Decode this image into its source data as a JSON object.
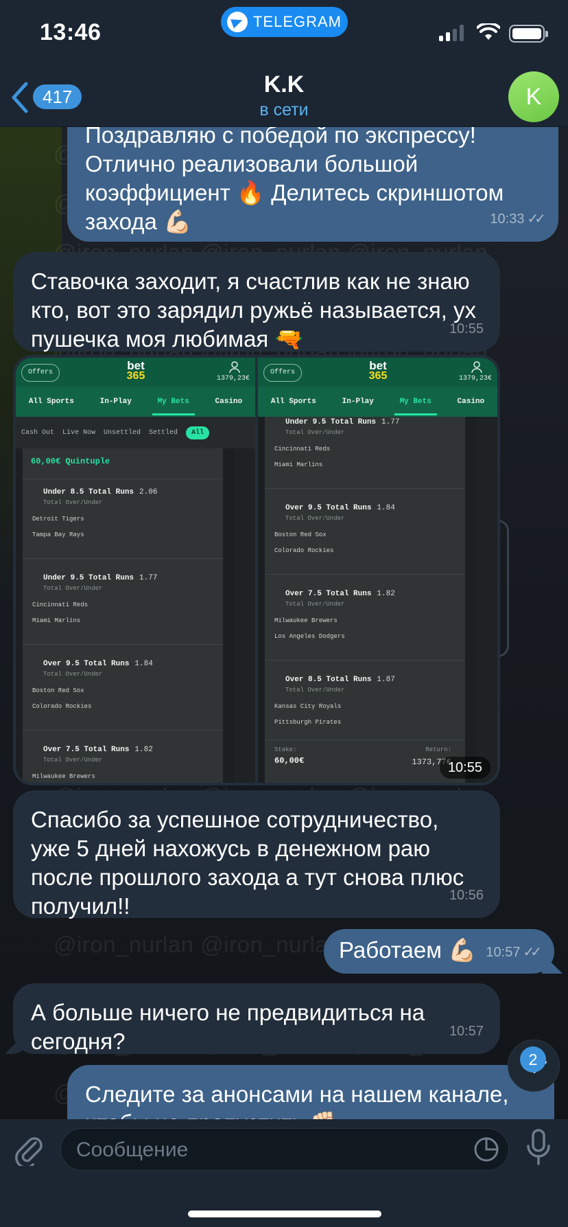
{
  "status_bar": {
    "time": "13:46",
    "pill": "TELEGRAM"
  },
  "header": {
    "back_count": "417",
    "title": "K.K",
    "status": "в сети",
    "avatar_letter": "K"
  },
  "watermark": "@iron_nurlan  @iron_nurlan  @iron_nurlan",
  "messages": [
    {
      "id": "m1",
      "dir": "out",
      "text": "Поздравляю с победой по экспрессу! Отлично реализовали большой коэффициент 🔥 Делитесь скриншотом захода 💪🏻",
      "time": "10:33"
    },
    {
      "id": "m2",
      "dir": "in",
      "text": "Ставочка заходит, я счастлив как не знаю кто, вот это зарядил ружьё называется, ух пушечка моя любимая 🔫",
      "time": "10:55"
    },
    {
      "id": "m3",
      "dir": "in",
      "type": "media",
      "time": "10:55"
    },
    {
      "id": "m4",
      "dir": "in",
      "text": "Спасибо за успешное сотрудничество, уже 5 дней нахожусь в денежном раю после прошлого захода а тут снова плюс получил!!",
      "time": "10:56"
    },
    {
      "id": "m5",
      "dir": "out",
      "text": "Работаем 💪🏻",
      "time": "10:57"
    },
    {
      "id": "m6",
      "dir": "in",
      "text": "А больше ничего не предвидиться на сегодня?",
      "time": "10:57"
    },
    {
      "id": "m7",
      "dir": "out",
      "text": "Следите за анонсами на нашем канале, чтобы не пропустить ✊🏻",
      "time": ""
    }
  ],
  "bet_app": {
    "offers": "Offers",
    "logo_top": "bet",
    "logo_bottom": "365",
    "balance": "1379,23€",
    "nav": [
      "All Sports",
      "In-Play",
      "My Bets",
      "Casino"
    ],
    "filters": [
      "Cash Out",
      "Live Now",
      "Unsettled",
      "Settled",
      "All"
    ],
    "bet_title": "60,00€ Quintuple",
    "selections": [
      {
        "name": "Under 8.5 Total Runs",
        "odds": "2.06",
        "market": "Total Over/Under",
        "team1": "Detroit Tigers",
        "team2": "Tampa Bay Rays"
      },
      {
        "name": "Under 9.5 Total Runs",
        "odds": "1.77",
        "market": "Total Over/Under",
        "team1": "Cincinnati Reds",
        "team2": "Miami Marlins"
      },
      {
        "name": "Over 9.5 Total Runs",
        "odds": "1.84",
        "market": "Total Over/Under",
        "team1": "Boston Red Sox",
        "team2": "Colorado Rockies"
      },
      {
        "name": "Over 7.5 Total Runs",
        "odds": "1.82",
        "market": "Total Over/Under",
        "team1": "Milwaukee Brewers",
        "team2": "Los Angeles Dodgers"
      },
      {
        "name": "Over 8.5 Total Runs",
        "odds": "1.87",
        "market": "Total Over/Under",
        "team1": "Kansas City Royals",
        "team2": "Pittsburgh Pirates"
      }
    ],
    "stake_label": "Stake:",
    "stake_value": "60,00€",
    "return_label": "Return:",
    "return_value": "1373,77€"
  },
  "fab": {
    "badge": "2"
  },
  "input": {
    "placeholder": "Сообщение"
  },
  "colors": {
    "bubble_in": "#232e3c",
    "bubble_out": "#3e6289",
    "accent": "#3d94dc",
    "bet_green": "#126446",
    "bet_accent": "#27e2a4"
  }
}
